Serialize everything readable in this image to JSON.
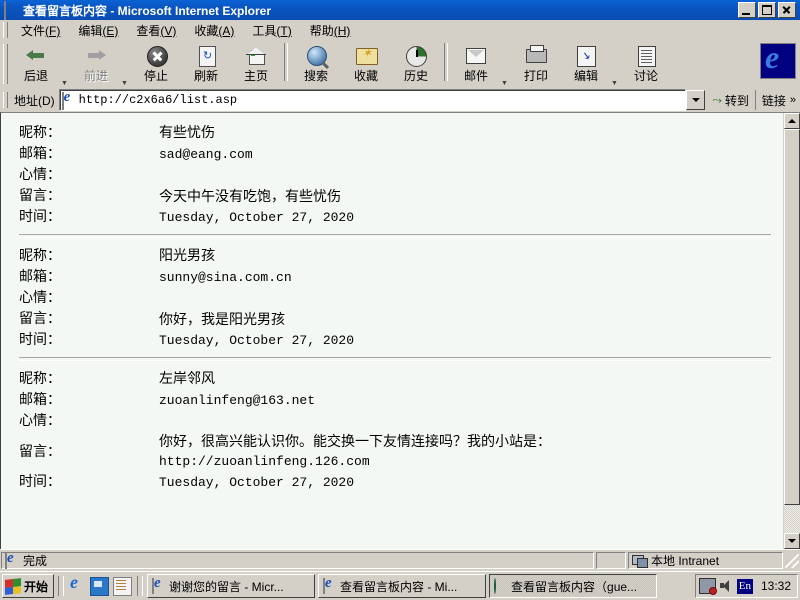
{
  "window": {
    "title": "查看留言板内容 - Microsoft Internet Explorer",
    "icon": "ie-document-icon",
    "buttons": {
      "minimize": "_",
      "restore": "❐",
      "close": "✕"
    }
  },
  "menu": {
    "items": [
      {
        "name": "文件",
        "accel": "(F)"
      },
      {
        "name": "编辑",
        "accel": "(E)"
      },
      {
        "name": "查看",
        "accel": "(V)"
      },
      {
        "name": "收藏",
        "accel": "(A)"
      },
      {
        "name": "工具",
        "accel": "(T)"
      },
      {
        "name": "帮助",
        "accel": "(H)"
      }
    ]
  },
  "toolbar": {
    "back": "后退",
    "forward": "前进",
    "stop": "停止",
    "refresh": "刷新",
    "home": "主页",
    "search": "搜索",
    "favorites": "收藏",
    "history": "历史",
    "mail": "邮件",
    "print": "打印",
    "edit": "编辑",
    "discuss": "讨论"
  },
  "address": {
    "label": "地址(D)",
    "url": "http://c2x6a6/list.asp",
    "go": "转到",
    "links": "链接",
    "links_chevron": "»"
  },
  "page": {
    "labels": {
      "nickname": "昵称：",
      "email": "邮箱：",
      "mood": "心情：",
      "message": "留言：",
      "time": "时间："
    },
    "entries": [
      {
        "nickname": "有些忧伤",
        "email": "sad@eang.com",
        "mood": "",
        "message": "今天中午没有吃饱，有些忧伤",
        "message_url": "",
        "time": "Tuesday, October 27, 2020"
      },
      {
        "nickname": "阳光男孩",
        "email": "sunny@sina.com.cn",
        "mood": "",
        "message": "你好，我是阳光男孩",
        "message_url": "",
        "time": "Tuesday, October 27, 2020"
      },
      {
        "nickname": "左岸邻风",
        "email": "zuoanlinfeng@163.net",
        "mood": "",
        "message": "你好，很高兴能认识你。能交换一下友情连接吗？我的小站是：",
        "message_url": "http://zuoanlinfeng.126.com",
        "time": "Tuesday, October 27, 2020"
      }
    ]
  },
  "statusbar": {
    "message": "完成",
    "zone": "本地 Intranet"
  },
  "taskbar": {
    "start": "开始",
    "quick_launch": [
      "ie-icon",
      "show-desktop-icon",
      "notepad-icon"
    ],
    "tasks": [
      {
        "label": "谢谢您的留言 - Micr...",
        "icon": "ie-icon",
        "active": false
      },
      {
        "label": "查看留言板内容 - Mi...",
        "icon": "ie-icon",
        "active": false
      },
      {
        "label": "查看留言板内容（gue...",
        "icon": "frontpage-icon",
        "active": true
      }
    ],
    "tray": {
      "language": "En",
      "clock": "13:32"
    }
  },
  "colors": {
    "titlebar": "#0a54c0",
    "chrome": "#d4d0c8",
    "page_bg": "#f4f8f4",
    "text": "#000000"
  }
}
